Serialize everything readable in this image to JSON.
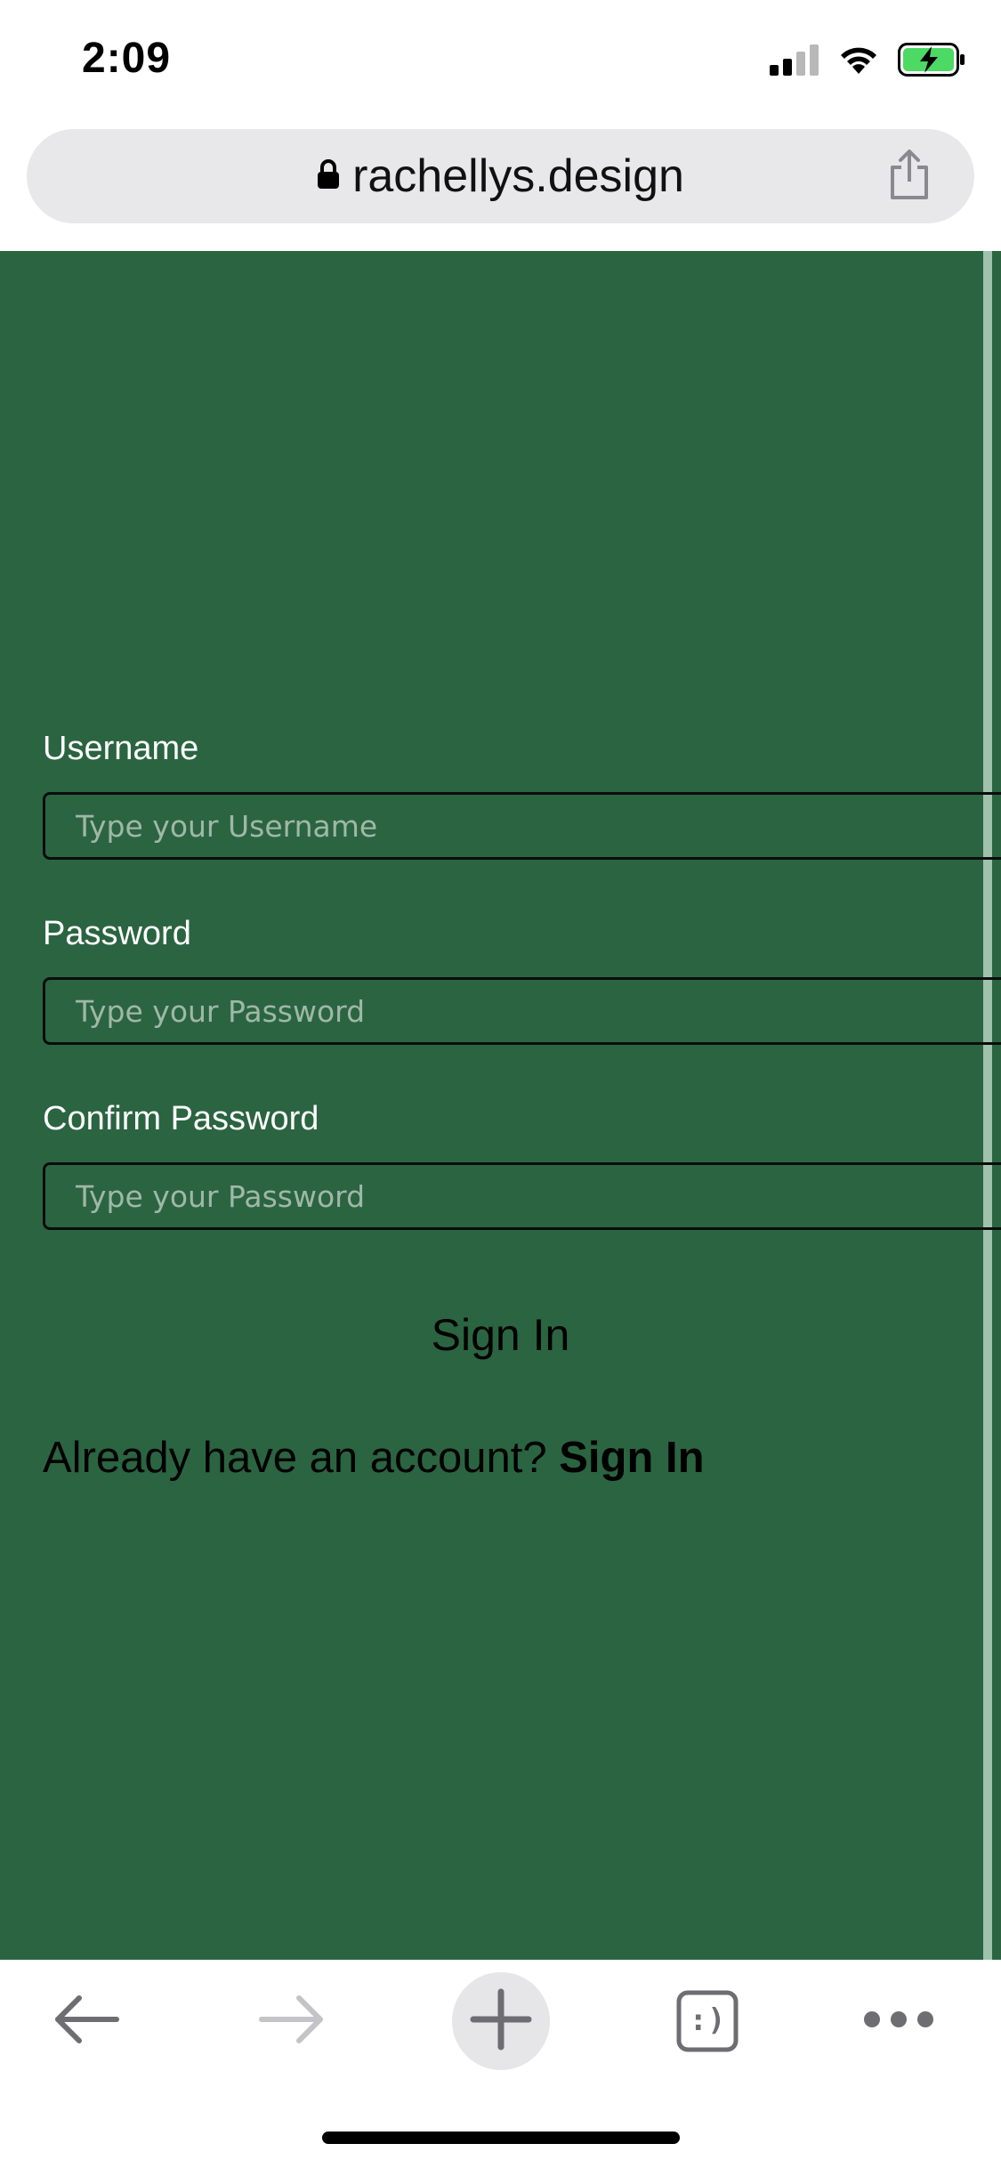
{
  "status_bar": {
    "time": "2:09",
    "icons": [
      "cellular-signal-icon",
      "wifi-icon",
      "battery-charging-icon"
    ]
  },
  "browser": {
    "url": "rachellys.design",
    "lock_icon": "lock-icon",
    "share_icon": "share-icon"
  },
  "form": {
    "background_color": "#2b6441",
    "username": {
      "label": "Username",
      "placeholder": "Type your Username",
      "value": ""
    },
    "password": {
      "label": "Password",
      "placeholder": "Type your Password",
      "value": ""
    },
    "confirm_password": {
      "label": "Confirm Password",
      "placeholder": "Type your Password",
      "value": ""
    },
    "submit_label": "Sign In",
    "already_text": "Already have an account?",
    "sign_in_link": "Sign In"
  },
  "toolbar": {
    "items": [
      "back-icon",
      "forward-icon",
      "new-tab-icon",
      "tabs-icon",
      "more-icon"
    ],
    "tabs_glyph": ":)"
  }
}
